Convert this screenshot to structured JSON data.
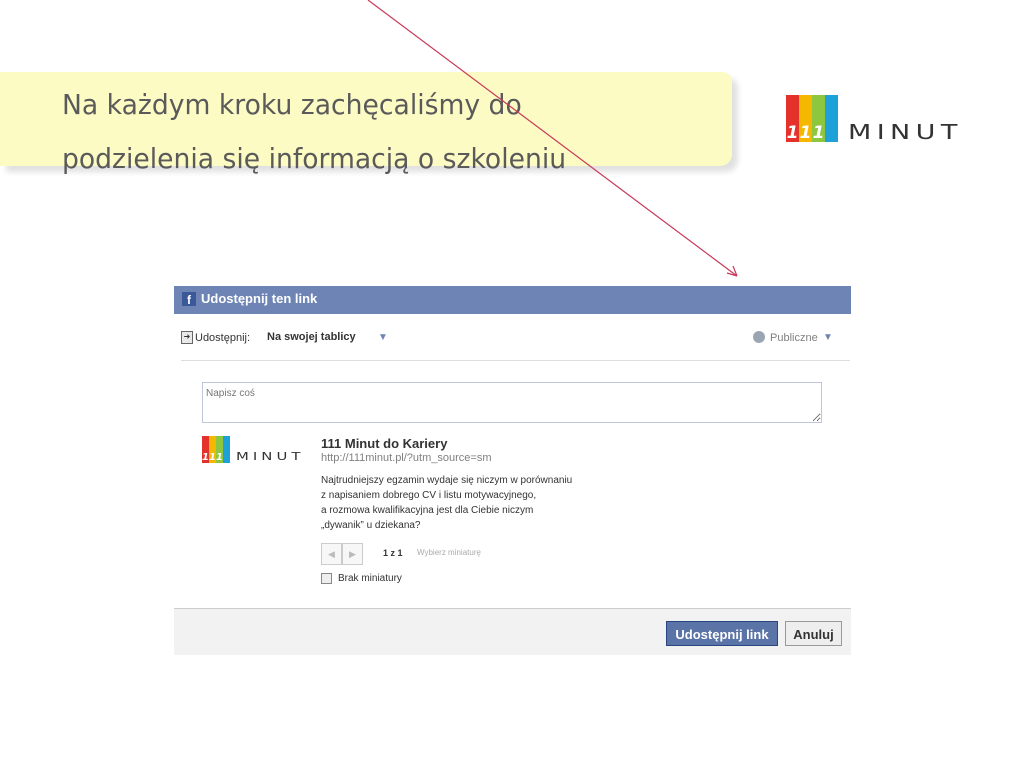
{
  "slide": {
    "heading": "Na każdym kroku zachęcaliśmy do podzielenia się informacją o szkoleniu",
    "logo": {
      "digits": [
        "1",
        "1",
        "1"
      ],
      "word": "MINUT",
      "bar_colors": [
        "#e4312b",
        "#f5b800",
        "#8dc63f",
        "#1ea1d9"
      ]
    },
    "arrow_color": "#c8385a",
    "banner_color": "#fdfbc4"
  },
  "dialog": {
    "header": {
      "icon_glyph": "f",
      "title": "Udostępnij ten link",
      "color": "#6d84b4"
    },
    "share_row": {
      "label": "Udostępnij:",
      "target": "Na swojej tablicy",
      "privacy": "Publiczne"
    },
    "message": {
      "placeholder": "Napisz coś",
      "value": ""
    },
    "preview": {
      "title": "111 Minut do Kariery",
      "url": "http://111minut.pl/?utm_source=sm",
      "description_lines": [
        "Najtrudniejszy egzamin wydaje się niczym w porównaniu",
        "z napisaniem dobrego CV i listu motywacyjnego,",
        "a rozmowa kwalifikacyjna jest dla Ciebie niczym",
        "„dywanik” u dziekana?"
      ],
      "pager": {
        "count": "1 z 1",
        "hint": "Wybierz miniaturę"
      },
      "no_thumbnail_label": "Brak miniatury",
      "no_thumbnail_checked": false
    },
    "footer": {
      "share_button": "Udostępnij link",
      "cancel_button": "Anuluj"
    },
    "icons": [
      "facebook-icon",
      "share-icon",
      "chevron-down-icon",
      "globe-icon",
      "prev-arrow-icon",
      "next-arrow-icon",
      "checkbox"
    ]
  }
}
